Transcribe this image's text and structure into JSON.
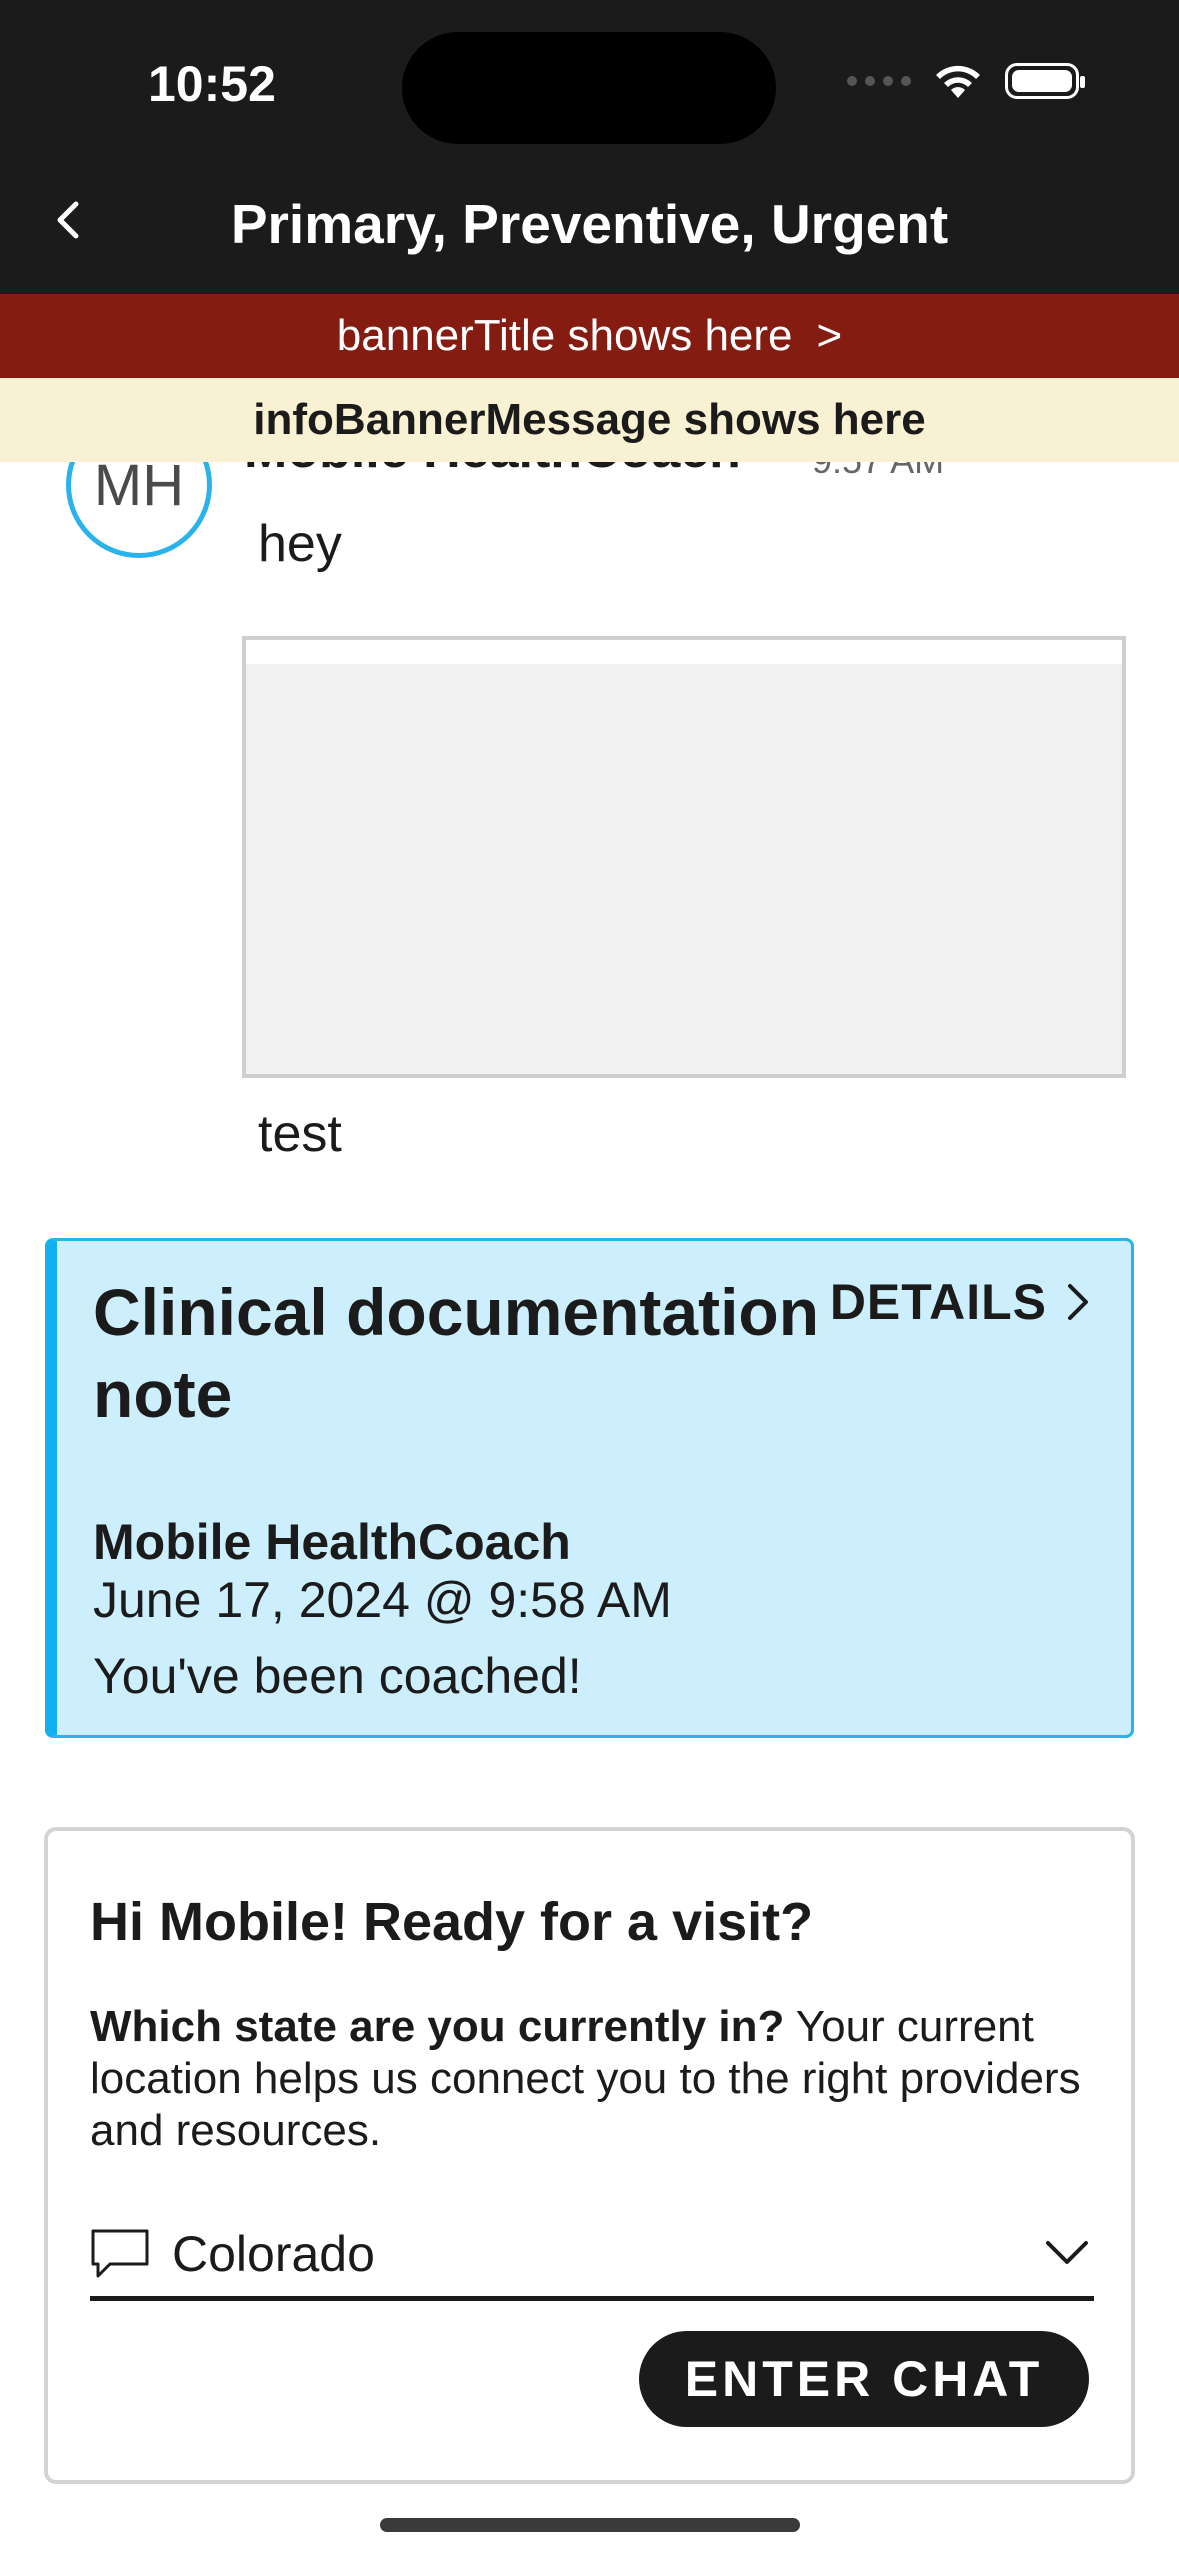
{
  "status_bar": {
    "time": "10:52"
  },
  "nav": {
    "title": "Primary, Preventive, Urgent"
  },
  "banner": {
    "title": "bannerTitle shows here",
    "chevron": ">"
  },
  "info_banner": {
    "message": "infoBannerMessage shows here"
  },
  "message": {
    "avatar_initials": "MH",
    "sender": "Mobile HealthCoach",
    "time": "9:57 AM",
    "text_before": "hey",
    "text_after": "test"
  },
  "note": {
    "title": "Clinical documentation note",
    "details_label": "DETAILS",
    "author": "Mobile HealthCoach",
    "date": "June 17, 2024 @ 9:58 AM",
    "body": "You've been coached!"
  },
  "visit": {
    "title": "Hi Mobile! Ready for a visit?",
    "question": "Which state are you currently in?",
    "description": " Your current location helps us connect you to the right providers and resources.",
    "selected_state": "Colorado",
    "button_label": "ENTER CHAT"
  },
  "colors": {
    "header_bg": "#1b1b1b",
    "banner_bg": "#841c12",
    "info_banner_bg": "#f8f1d3",
    "accent": "#29b2ec",
    "note_bg": "#cdeefc"
  }
}
